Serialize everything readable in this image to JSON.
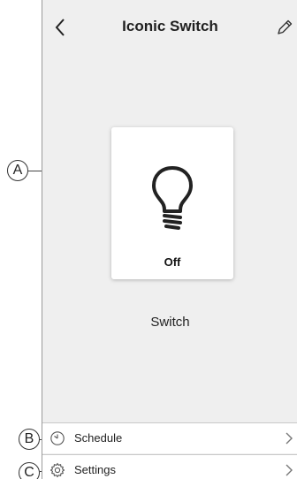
{
  "header": {
    "title": "Iconic Switch",
    "back_icon": "chevron-left-icon",
    "edit_icon": "pencil-icon"
  },
  "device_card": {
    "icon": "light-bulb-icon",
    "state": "Off"
  },
  "device_label": "Switch",
  "menu": [
    {
      "label": "Schedule",
      "icon": "clock-icon",
      "chevron": "chevron-right-icon"
    },
    {
      "label": "Settings",
      "icon": "gear-icon",
      "chevron": "chevron-right-icon"
    }
  ],
  "callouts": {
    "a": "A",
    "b": "B",
    "c": "C"
  }
}
